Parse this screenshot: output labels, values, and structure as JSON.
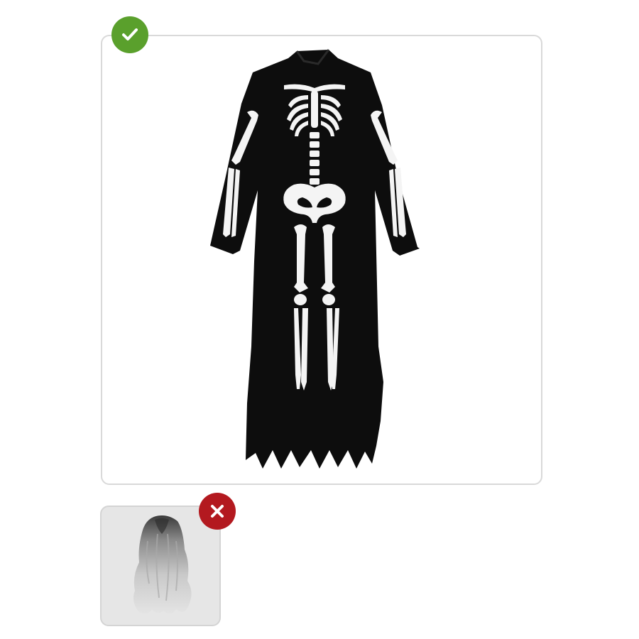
{
  "options": [
    {
      "name": "skeleton-costume",
      "status": "correct",
      "status_icon": "checkmark-icon",
      "badge_color": "#5aa02c"
    },
    {
      "name": "gray-wig",
      "status": "incorrect",
      "status_icon": "cross-icon",
      "badge_color": "#b3191f"
    }
  ],
  "colors": {
    "card_border": "#d9d9d9",
    "robe": "#0d0d0d",
    "bone": "#f4f4f4",
    "wig_card_bg": "#e6e6e6"
  }
}
